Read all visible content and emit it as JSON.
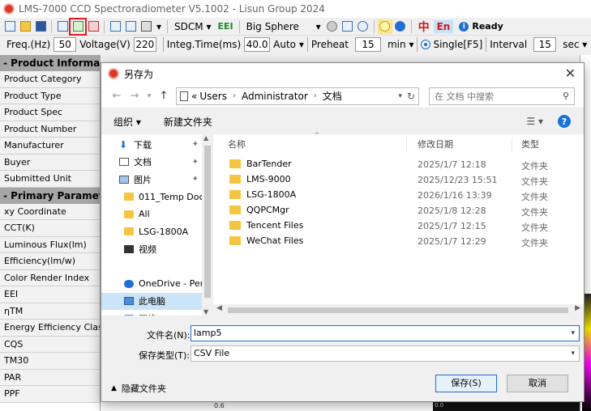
{
  "app": {
    "title": "LMS-7000 CCD Spectroradiometer V5.1002 - Lisun Group 2024",
    "toolbar": {
      "sdcm_label": "SDCM",
      "eei_label": "EEI",
      "sphere_label": "Big Sphere",
      "lang_zh": "中",
      "lang_en": "En",
      "status": "Ready"
    },
    "params": {
      "freq_label": "Freq.(Hz)",
      "freq_value": "50",
      "voltage_label": "Voltage(V)",
      "voltage_value": "220",
      "integ_label": "Integ.Time(ms)",
      "integ_value": "40.0",
      "auto_label": "Auto",
      "preheat_label": "Preheat",
      "preheat_value": "15",
      "preheat_unit": "min",
      "single_label": "Single[F5]",
      "interval_label": "Interval",
      "interval_value": "15",
      "interval_unit": "sec"
    },
    "left_panel": {
      "product_section": "- Product Information",
      "product_rows": [
        "Product Category",
        "Product Type",
        "Product Spec",
        "Product Number",
        "Manufacturer",
        "Buyer",
        "Submitted Unit"
      ],
      "primary_section": "- Primary Parameters",
      "primary_rows": [
        "xy Coordinate",
        "CCT(K)",
        "Luminous Flux(lm)",
        "Efficiency(lm/w)",
        "Color Render Index",
        "EEI",
        "ηTM",
        "Energy Efficiency Class",
        "CQS",
        "TM30",
        "PAR",
        "PPF"
      ]
    },
    "bottom_value": "0.6",
    "bottom_dark_label": "0.0"
  },
  "dialog": {
    "title": "另存为",
    "address": {
      "prefix": "«",
      "crumbs": [
        "Users",
        "Administrator",
        "文档"
      ]
    },
    "search_placeholder": "在 文档 中搜索",
    "commands": {
      "organize": "组织 ▾",
      "new_folder": "新建文件夹",
      "view": "☰ ▾",
      "help": "?"
    },
    "nav_items": [
      {
        "label": "下载",
        "icon": "download-icon",
        "pinned": true
      },
      {
        "label": "文档",
        "icon": "document-icon",
        "pinned": true
      },
      {
        "label": "图片",
        "icon": "picture-icon",
        "pinned": true
      },
      {
        "label": "011_Temp Doc",
        "icon": "folder-icon",
        "pinned": false
      },
      {
        "label": "All",
        "icon": "folder-icon",
        "pinned": false
      },
      {
        "label": "LSG-1800A",
        "icon": "folder-icon",
        "pinned": false
      },
      {
        "label": "视频",
        "icon": "video-icon",
        "pinned": false
      },
      {
        "label": "",
        "icon": "",
        "pinned": false
      },
      {
        "label": "OneDrive - Perso",
        "icon": "onedrive-icon",
        "pinned": false
      },
      {
        "label": "此电脑",
        "icon": "computer-icon",
        "pinned": false,
        "selected": true
      },
      {
        "label": "网络",
        "icon": "network-icon",
        "pinned": false
      }
    ],
    "columns": {
      "name": "名称",
      "modified": "修改日期",
      "type": "类型"
    },
    "files": [
      {
        "name": "BarTender",
        "modified": "2025/1/7 12:18",
        "type": "文件夹"
      },
      {
        "name": "LMS-9000",
        "modified": "2025/12/23 15:51",
        "type": "文件夹"
      },
      {
        "name": "LSG-1800A",
        "modified": "2026/1/16 13:39",
        "type": "文件夹"
      },
      {
        "name": "QQPCMgr",
        "modified": "2025/1/8 12:28",
        "type": "文件夹"
      },
      {
        "name": "Tencent Files",
        "modified": "2025/1/7 12:15",
        "type": "文件夹"
      },
      {
        "name": "WeChat Files",
        "modified": "2025/1/7 12:29",
        "type": "文件夹"
      }
    ],
    "filename_label": "文件名(N):",
    "filename_value": "lamp5",
    "filetype_label": "保存类型(T):",
    "filetype_value": "CSV File",
    "hide_folders": "隐藏文件夹",
    "save_button": "保存(S)",
    "cancel_button": "取消",
    "colors": {
      "accent": "#1f6fd6",
      "selected": "#cce4f7",
      "folder": "#f5c542",
      "highlight_box": "#e21c1c"
    }
  }
}
